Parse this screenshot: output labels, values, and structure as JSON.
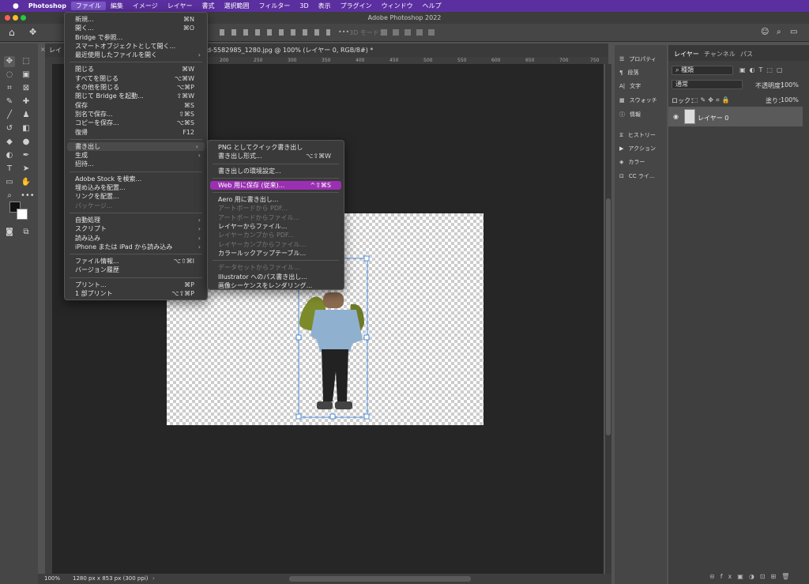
{
  "menubar": {
    "app": "Photoshop",
    "items": [
      "ファイル",
      "編集",
      "イメージ",
      "レイヤー",
      "書式",
      "選択範囲",
      "フィルター",
      "3D",
      "表示",
      "プラグイン",
      "ウィンドウ",
      "ヘルプ"
    ]
  },
  "window_title": "Adobe Photoshop 2022",
  "options": {
    "mode3d": "3D モード："
  },
  "tabs": {
    "left": "レイ",
    "doc": "d-5582985_1280.jpg @ 100% (レイヤー 0, RGB/8#) *"
  },
  "ruler_ticks": [
    "200",
    "250",
    "300",
    "350",
    "400",
    "450",
    "500",
    "550",
    "600",
    "650",
    "700",
    "750"
  ],
  "status": {
    "zoom": "100%",
    "size": "1280 px x 853 px (300 ppi)"
  },
  "file_menu": [
    {
      "label": "新規...",
      "sc": "⌘N"
    },
    {
      "label": "開く...",
      "sc": "⌘O"
    },
    {
      "label": "Bridge で参照...",
      "sc": ""
    },
    {
      "label": "スマートオブジェクトとして開く...",
      "sc": ""
    },
    {
      "label": "最近使用したファイルを開く",
      "sc": "",
      "arrow": "›"
    },
    {
      "sep": true
    },
    {
      "label": "閉じる",
      "sc": "⌘W"
    },
    {
      "label": "すべてを閉じる",
      "sc": "⌥⌘W"
    },
    {
      "label": "その他を閉じる",
      "sc": "⌥⌘P"
    },
    {
      "label": "閉じて Bridge を起動...",
      "sc": "⇧⌘W"
    },
    {
      "label": "保存",
      "sc": "⌘S"
    },
    {
      "label": "別名で保存...",
      "sc": "⇧⌘S"
    },
    {
      "label": "コピーを保存...",
      "sc": "⌥⌘S"
    },
    {
      "label": "復帰",
      "sc": "F12"
    },
    {
      "sep": true
    },
    {
      "label": "書き出し",
      "sc": "",
      "arrow": "›",
      "hl": true
    },
    {
      "label": "生成",
      "sc": "",
      "arrow": "›"
    },
    {
      "label": "招待...",
      "sc": ""
    },
    {
      "sep": true
    },
    {
      "label": "Adobe Stock を検索...",
      "sc": ""
    },
    {
      "label": "埋め込みを配置...",
      "sc": ""
    },
    {
      "label": "リンクを配置...",
      "sc": ""
    },
    {
      "label": "パッケージ...",
      "sc": "",
      "dis": true
    },
    {
      "sep": true
    },
    {
      "label": "自動処理",
      "sc": "",
      "arrow": "›"
    },
    {
      "label": "スクリプト",
      "sc": "",
      "arrow": "›"
    },
    {
      "label": "読み込み",
      "sc": "",
      "arrow": "›"
    },
    {
      "label": "iPhone または iPad から読み込み",
      "sc": "",
      "arrow": "›"
    },
    {
      "sep": true
    },
    {
      "label": "ファイル情報...",
      "sc": "⌥⇧⌘I"
    },
    {
      "label": "バージョン履歴",
      "sc": ""
    },
    {
      "sep": true
    },
    {
      "label": "プリント...",
      "sc": "⌘P"
    },
    {
      "label": "1 部プリント",
      "sc": "⌥⇧⌘P"
    }
  ],
  "export_menu": [
    {
      "label": "PNG としてクイック書き出し",
      "sc": ""
    },
    {
      "label": "書き出し形式...",
      "sc": "⌥⇧⌘W"
    },
    {
      "sep": true
    },
    {
      "label": "書き出しの環境設定...",
      "sc": ""
    },
    {
      "sep": true
    },
    {
      "label": "Web 用に保存 (従来)...",
      "sc": "^⇧⌘S",
      "sel": true
    },
    {
      "sep": true
    },
    {
      "label": "Aero 用に書き出し...",
      "sc": ""
    },
    {
      "label": "アートボードから PDF...",
      "sc": "",
      "dis": true
    },
    {
      "label": "アートボードからファイル...",
      "sc": "",
      "dis": true
    },
    {
      "label": "レイヤーからファイル...",
      "sc": ""
    },
    {
      "label": "レイヤーカンプから PDF...",
      "sc": "",
      "dis": true
    },
    {
      "label": "レイヤーカンプからファイル...",
      "sc": "",
      "dis": true
    },
    {
      "label": "カラールックアップテーブル...",
      "sc": ""
    },
    {
      "sep": true
    },
    {
      "label": "データセットからファイル...",
      "sc": "",
      "dis": true
    },
    {
      "label": "Illustrator へのパス書き出し...",
      "sc": ""
    },
    {
      "label": "画像シーケンスをレンダリング...",
      "sc": ""
    }
  ],
  "side_panels": [
    {
      "icon": "properties-icon",
      "label": "プロパティ"
    },
    {
      "icon": "paragraph-icon",
      "label": "段落"
    },
    {
      "icon": "character-icon",
      "label": "文字"
    },
    {
      "icon": "swatches-icon",
      "label": "スウォッチ"
    },
    {
      "icon": "info-icon",
      "label": "情報"
    },
    {
      "icon": "history-icon",
      "label": "ヒストリー"
    },
    {
      "icon": "actions-icon",
      "label": "アクション"
    },
    {
      "icon": "color-icon",
      "label": "カラー"
    },
    {
      "icon": "cc-libraries-icon",
      "label": "CC ライ..."
    }
  ],
  "layers_panel": {
    "tabs": [
      "レイヤー",
      "チャンネル",
      "パス"
    ],
    "filter": "種類",
    "blend": "通常",
    "opacity_label": "不透明度：",
    "opacity": "100%",
    "lock_label": "ロック：",
    "fill_label": "塗り：",
    "fill": "100%",
    "layer_name": "レイヤー 0"
  }
}
